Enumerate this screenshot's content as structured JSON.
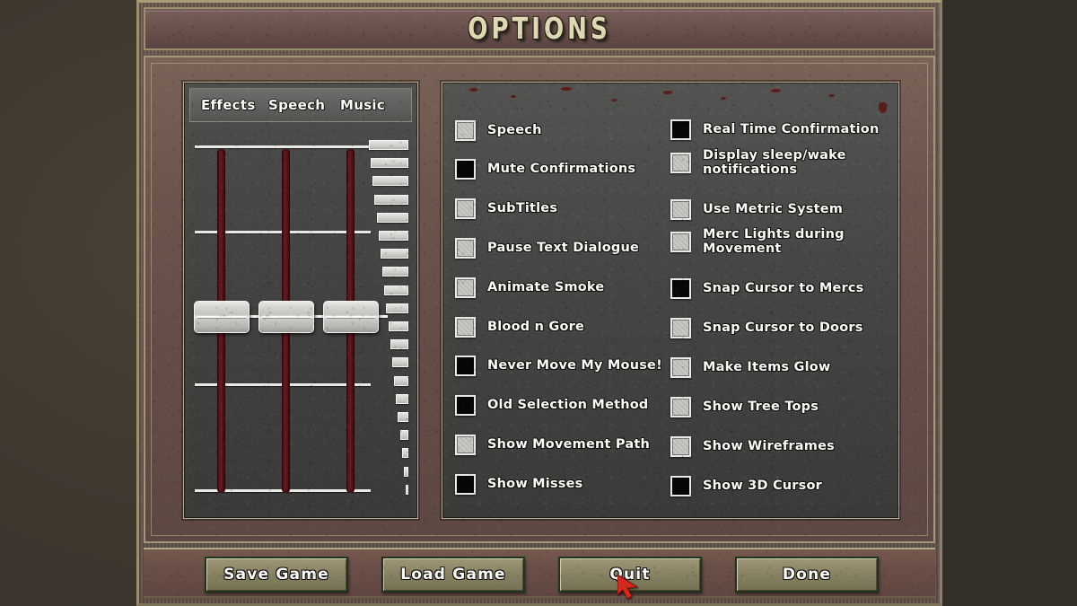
{
  "window": {
    "title": "OPTIONS",
    "accent_cream": "#ded8b4",
    "panel_brown": "#6d554e",
    "inset_gray": "#454544",
    "slider_red": "#6b1a1e",
    "button_olive": "#8d8768",
    "cursor_red": "#d42a1e"
  },
  "sliders": {
    "labels": [
      {
        "name": "effects",
        "label": "Effects"
      },
      {
        "name": "speech",
        "label": "Speech"
      },
      {
        "name": "music",
        "label": "Music"
      }
    ],
    "values": [
      45,
      45,
      45
    ],
    "tick_count": 4,
    "meter_steps": 20
  },
  "options": {
    "left_column": [
      {
        "label": "Speech",
        "checked": false
      },
      {
        "label": "Mute Confirmations",
        "checked": true
      },
      {
        "label": "SubTitles",
        "checked": false
      },
      {
        "label": "Pause Text Dialogue",
        "checked": false
      },
      {
        "label": "Animate Smoke",
        "checked": false
      },
      {
        "label": "Blood n Gore",
        "checked": false
      },
      {
        "label": "Never Move My Mouse!",
        "checked": true
      },
      {
        "label": "Old Selection Method",
        "checked": true
      },
      {
        "label": "Show Movement Path",
        "checked": false
      },
      {
        "label": "Show Misses",
        "checked": true
      }
    ],
    "right_column": [
      {
        "label": "Real Time Confirmation",
        "checked": true
      },
      {
        "label": "Display sleep/wake\nnotifications",
        "checked": false
      },
      {
        "label": "Use Metric System",
        "checked": false
      },
      {
        "label": "Merc Lights during\nMovement",
        "checked": false
      },
      {
        "label": "Snap Cursor to Mercs",
        "checked": true
      },
      {
        "label": "Snap Cursor to Doors",
        "checked": false
      },
      {
        "label": "Make Items Glow",
        "checked": false
      },
      {
        "label": "Show Tree Tops",
        "checked": false
      },
      {
        "label": "Show Wireframes",
        "checked": false
      },
      {
        "label": "Show 3D Cursor",
        "checked": true
      }
    ]
  },
  "buttons": [
    {
      "name": "save-game",
      "label": "Save Game"
    },
    {
      "name": "load-game",
      "label": "Load Game"
    },
    {
      "name": "quit",
      "label": "Quit"
    },
    {
      "name": "done",
      "label": "Done"
    }
  ],
  "cursor": {
    "icon": "arrow-cursor-icon"
  }
}
